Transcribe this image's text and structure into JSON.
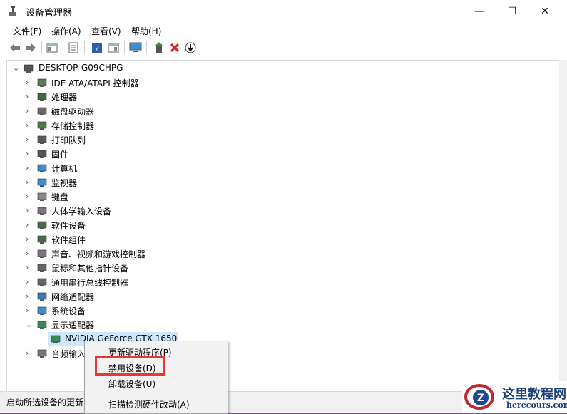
{
  "window": {
    "title": "设备管理器",
    "minimize_glyph": "—",
    "maximize_glyph": "☐",
    "close_glyph": "✕"
  },
  "menu": [
    "文件(F)",
    "操作(A)",
    "查看(V)",
    "帮助(H)"
  ],
  "toolbar": {
    "icons": [
      "back-icon",
      "forward-icon",
      "show-hide-console-tree-icon",
      "properties-icon",
      "help-icon",
      "action-view-icon",
      "monitor-icon",
      "update-driver-icon",
      "uninstall-icon",
      "scan-hardware-icon"
    ]
  },
  "tree": {
    "root": "DESKTOP-G09CHPG",
    "items": [
      {
        "label": "IDE ATA/ATAPI 控制器",
        "icon": "ide-controller-icon"
      },
      {
        "label": "处理器",
        "icon": "processor-icon"
      },
      {
        "label": "磁盘驱动器",
        "icon": "disk-drive-icon"
      },
      {
        "label": "存储控制器",
        "icon": "storage-controller-icon"
      },
      {
        "label": "打印队列",
        "icon": "printer-icon"
      },
      {
        "label": "固件",
        "icon": "firmware-icon"
      },
      {
        "label": "计算机",
        "icon": "computer-icon"
      },
      {
        "label": "监视器",
        "icon": "monitor-icon"
      },
      {
        "label": "键盘",
        "icon": "keyboard-icon"
      },
      {
        "label": "人体学输入设备",
        "icon": "hid-icon"
      },
      {
        "label": "软件设备",
        "icon": "software-device-icon"
      },
      {
        "label": "软件组件",
        "icon": "software-component-icon"
      },
      {
        "label": "声音、视频和游戏控制器",
        "icon": "sound-icon"
      },
      {
        "label": "鼠标和其他指针设备",
        "icon": "mouse-icon"
      },
      {
        "label": "通用串行总线控制器",
        "icon": "usb-icon"
      },
      {
        "label": "网络适配器",
        "icon": "network-adapter-icon"
      },
      {
        "label": "系统设备",
        "icon": "system-device-icon"
      },
      {
        "label": "显示适配器",
        "icon": "display-adapter-icon"
      }
    ],
    "expanded_child": "NVIDIA GeForce GTX 1650",
    "partial_item": "音频输入"
  },
  "context_menu": {
    "items": [
      "更新驱动程序(P)",
      "禁用设备(D)",
      "卸载设备(U)",
      "扫描检测硬件改动(A)"
    ],
    "highlight_color": "#e53935"
  },
  "status": {
    "text": "启动所选设备的更新"
  },
  "watermark": {
    "title": "这里教程网",
    "url": "herecours.com",
    "logo_letter": "Z"
  }
}
